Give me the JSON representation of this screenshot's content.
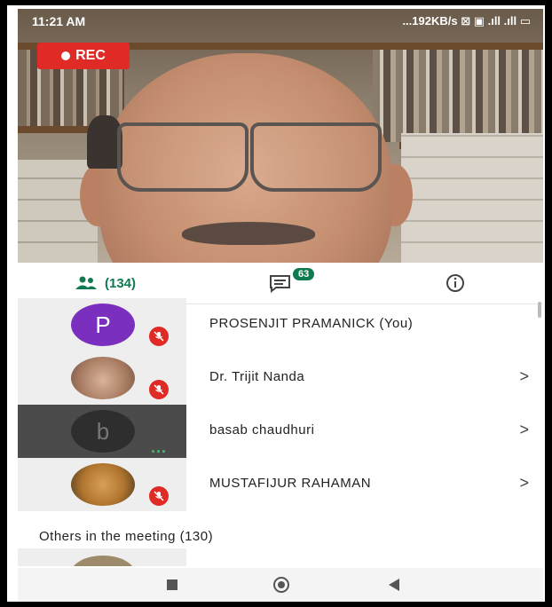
{
  "status_bar": {
    "time": "11:21 AM",
    "right": "...192KB/s ⊠ ▣ .ıll .ıll ▭"
  },
  "recording": {
    "label": "REC"
  },
  "tabs": {
    "people_count": "(134)",
    "chat_badge": "63"
  },
  "participants": [
    {
      "name": "PROSENJIT PRAMANICK (You)",
      "avatar_letter": "P",
      "avatar_color": "#7b2fbe",
      "muted": true,
      "chevron": ""
    },
    {
      "name": "Dr. Trijit Nanda",
      "avatar_letter": "",
      "avatar_color": "#b38d74",
      "muted": true,
      "chevron": ">"
    },
    {
      "name": "basab chaudhuri",
      "avatar_letter": "b",
      "avatar_color": "#2e2e2e",
      "muted": false,
      "speaking_dots": "...",
      "chevron": ">"
    },
    {
      "name": "MUSTAFIJUR RAHAMAN",
      "avatar_letter": "",
      "avatar_color": "#c88a3a",
      "muted": true,
      "chevron": ">"
    }
  ],
  "others_section": {
    "title": "Others in the meeting (130)"
  },
  "colors": {
    "accent": "#0f7a4f",
    "rec": "#e02a25",
    "purple": "#7b2fbe"
  }
}
